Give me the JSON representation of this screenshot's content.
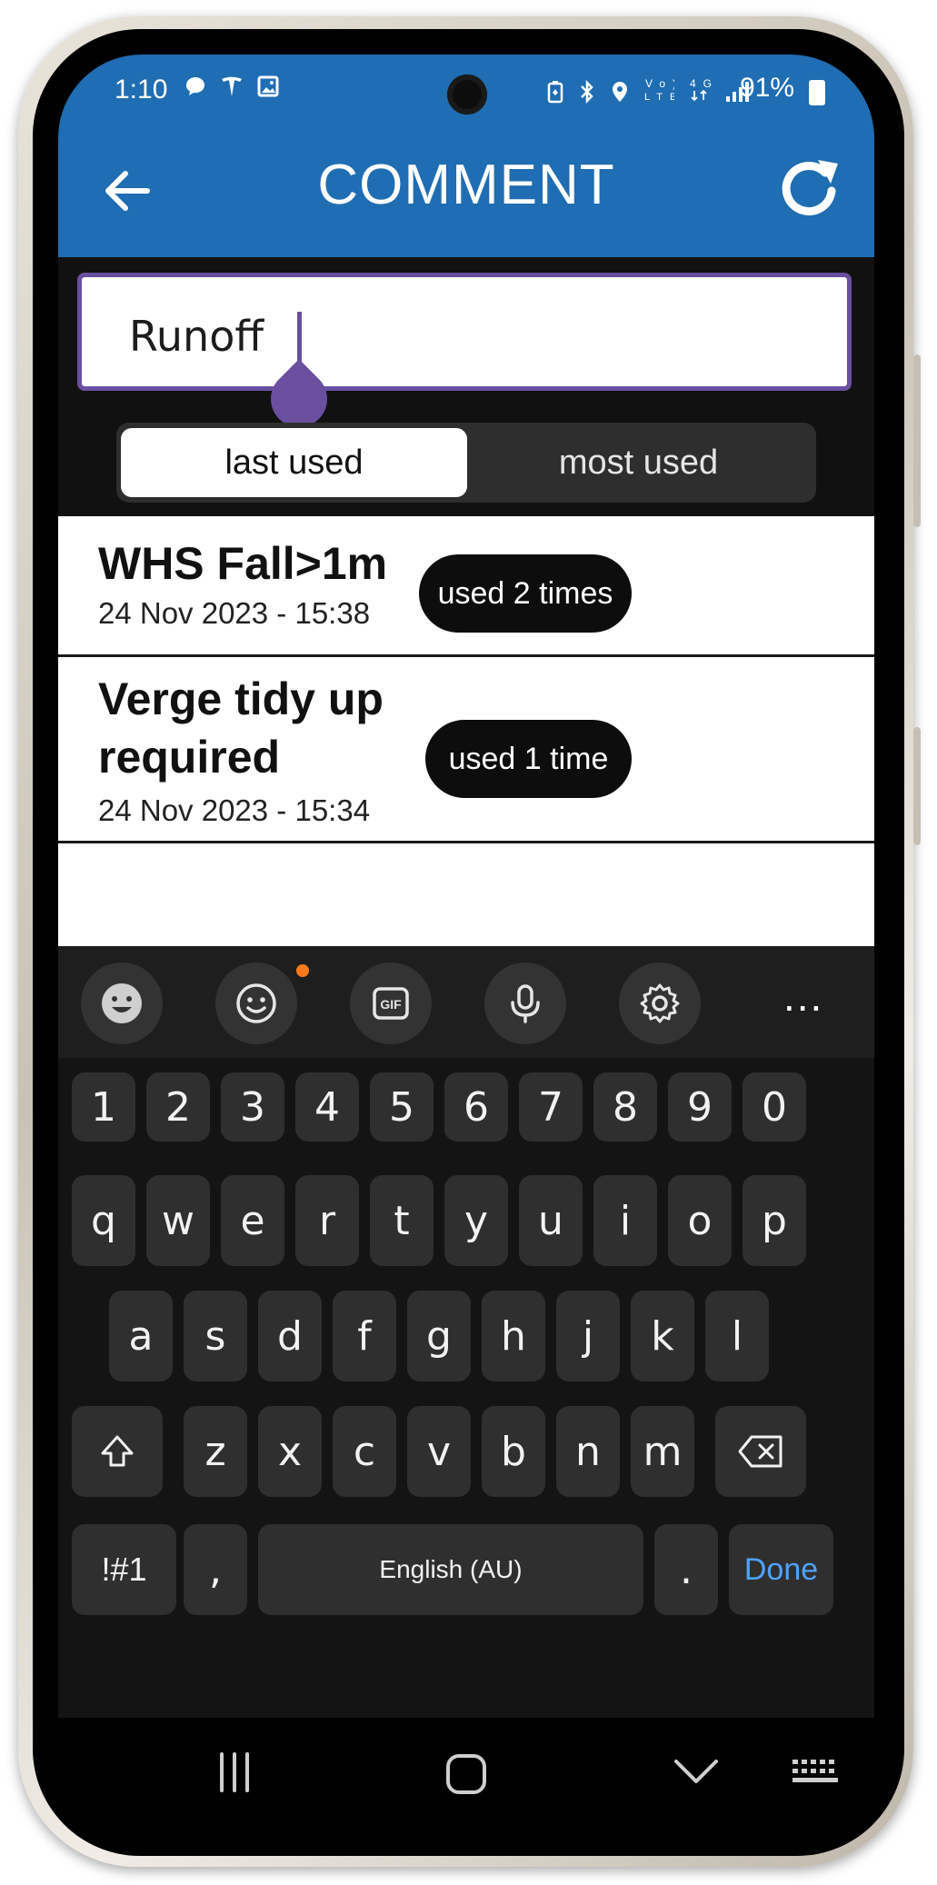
{
  "status_bar": {
    "time": "1:10",
    "left_icons": [
      "chat-icon",
      "tesla-icon",
      "image-icon"
    ],
    "right_icons": [
      "battery-saver-icon",
      "bluetooth-icon",
      "location-icon",
      "volte-icon",
      "4g-icon",
      "signal-icon"
    ],
    "vo_label": "Vo)",
    "lte_label": "LTE1",
    "net_label": "4G",
    "battery": "91%"
  },
  "header": {
    "title": "COMMENT",
    "back_icon": "arrow-left-icon",
    "refresh_icon": "refresh-icon",
    "color": "#1f6db3"
  },
  "search": {
    "value": "Runoff",
    "accent": "#6a4fa0"
  },
  "sort_toggle": {
    "options": [
      "last used",
      "most used"
    ],
    "selected": "last used"
  },
  "comments": [
    {
      "title": "WHS Fall>1m",
      "date": "24 Nov 2023 - 15:38",
      "usage": "used 2 times"
    },
    {
      "title_line1": "Verge tidy up",
      "title_line2": "required",
      "date": "24 Nov 2023 - 15:34",
      "usage": "used 1 time"
    }
  ],
  "keyboard": {
    "toolbar": [
      "emoji-face-icon",
      "sticker-icon",
      "gif-icon",
      "microphone-icon",
      "gear-icon",
      "more-icon"
    ],
    "gif_label": "GIF",
    "more_label": "...",
    "numbers": [
      "1",
      "2",
      "3",
      "4",
      "5",
      "6",
      "7",
      "8",
      "9",
      "0"
    ],
    "row1": [
      "q",
      "w",
      "e",
      "r",
      "t",
      "y",
      "u",
      "i",
      "o",
      "p"
    ],
    "row2": [
      "a",
      "s",
      "d",
      "f",
      "g",
      "h",
      "j",
      "k",
      "l"
    ],
    "row3": [
      "z",
      "x",
      "c",
      "v",
      "b",
      "n",
      "m"
    ],
    "symbols_label": "!#1",
    "comma_label": ",",
    "space_label": "English (AU)",
    "period_label": ".",
    "done_label": "Done",
    "done_color": "#4ea3ff"
  },
  "nav": [
    "recent-apps-icon",
    "home-icon",
    "back-chevron-icon",
    "keyboard-switch-icon"
  ]
}
